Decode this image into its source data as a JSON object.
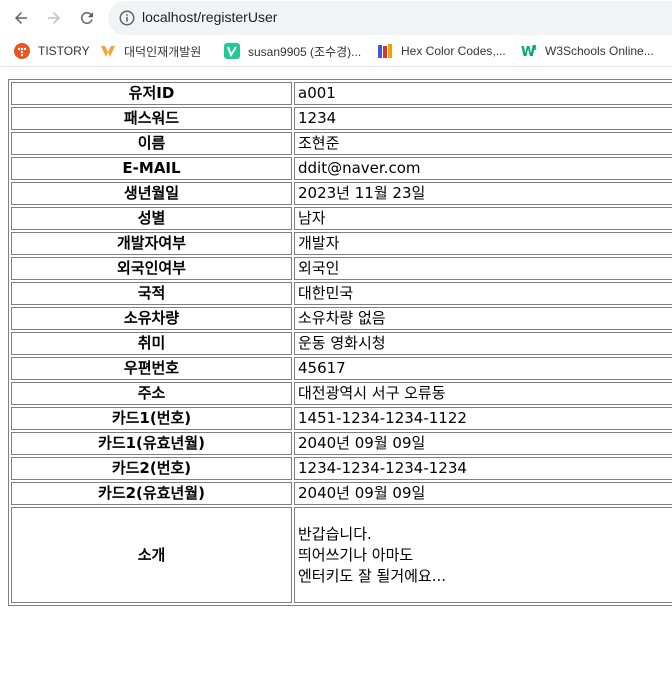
{
  "browser": {
    "url": "localhost/registerUser",
    "bookmarks": [
      {
        "label": "TISTORY",
        "icon": "tistory-icon",
        "color": "#eb531f"
      },
      {
        "label": "대덕인재개발원",
        "icon": "ddit-icon",
        "color": "#f6a43a"
      },
      {
        "label": "susan9905 (조수경)...",
        "icon": "velog-icon",
        "color": "#20c997"
      },
      {
        "label": "Hex Color Codes,...",
        "icon": "books-icon",
        "color": "#3b5bdb"
      },
      {
        "label": "W3Schools Online...",
        "icon": "w3schools-icon",
        "color": "#04aa6d"
      }
    ]
  },
  "form": {
    "rows": [
      {
        "label": "유저ID",
        "value": "a001"
      },
      {
        "label": "패스워드",
        "value": "1234"
      },
      {
        "label": "이름",
        "value": "조현준"
      },
      {
        "label": "E-MAIL",
        "value": "ddit@naver.com"
      },
      {
        "label": "생년월일",
        "value": "2023년 11월 23일"
      },
      {
        "label": "성별",
        "value": "남자"
      },
      {
        "label": "개발자여부",
        "value": "개발자"
      },
      {
        "label": "외국인여부",
        "value": "외국인"
      },
      {
        "label": "국적",
        "value": "대한민국"
      },
      {
        "label": "소유차량",
        "value": "소유차량 없음"
      },
      {
        "label": "취미",
        "value": "운동 영화시청"
      },
      {
        "label": "우편번호",
        "value": "45617"
      },
      {
        "label": "주소",
        "value": "대전광역시 서구 오류동"
      },
      {
        "label": "카드1(번호)",
        "value": "1451-1234-1234-1122"
      },
      {
        "label": "카드1(유효년월)",
        "value": "2040년 09월 09일"
      },
      {
        "label": "카드2(번호)",
        "value": "1234-1234-1234-1234"
      },
      {
        "label": "카드2(유효년월)",
        "value": "2040년 09월 09일"
      }
    ],
    "intro": {
      "label": "소개",
      "lines": [
        "반갑습니다.",
        "띄어쓰기나 아마도",
        "엔터키도 잘 될거에요..."
      ]
    }
  }
}
